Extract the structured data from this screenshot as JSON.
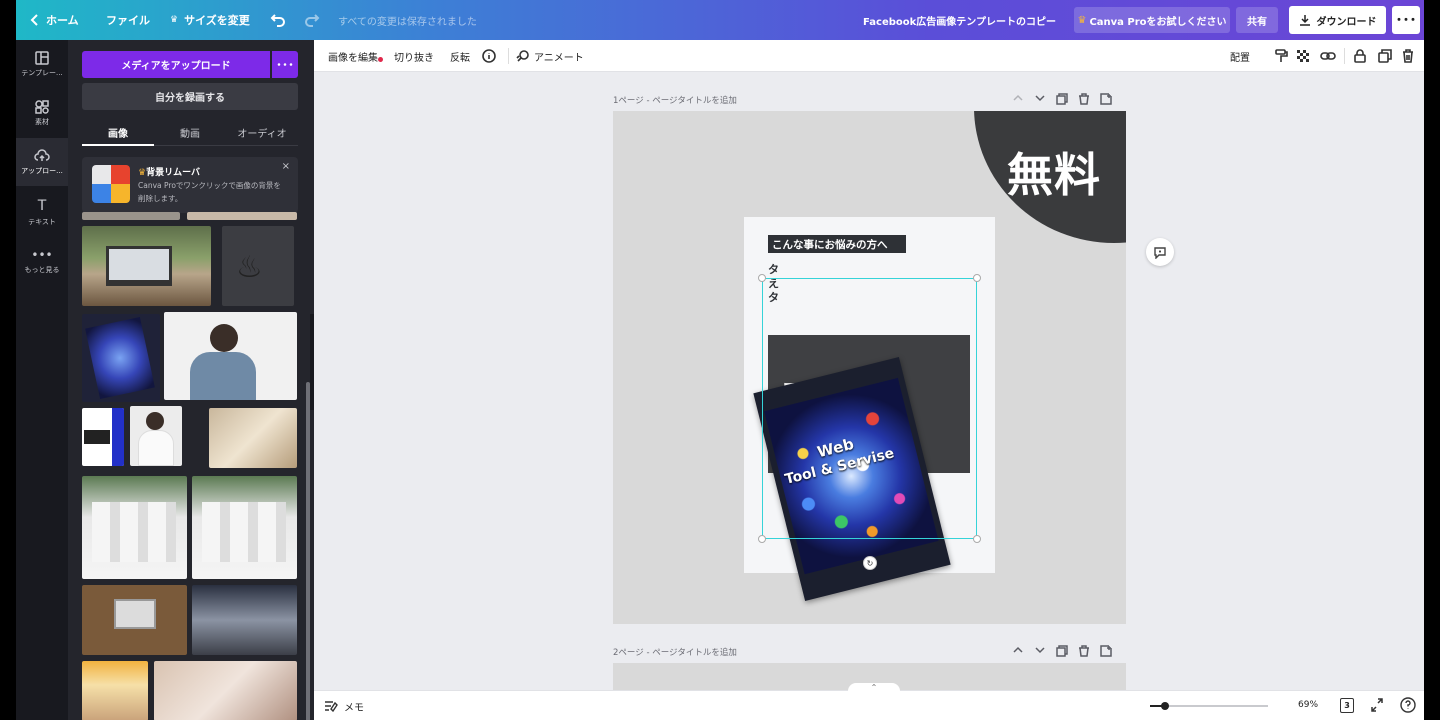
{
  "topbar": {
    "home": "ホーム",
    "file": "ファイル",
    "resize": "サイズを変更",
    "saved_status": "すべての変更は保存されました",
    "doc_title": "Facebook広告画像テンプレートのコピー",
    "try_pro": "Canva Proをお試しください",
    "share": "共有",
    "download": "ダウンロード",
    "more": "･･･"
  },
  "rail": [
    {
      "label": "テンプレー..."
    },
    {
      "label": "素材"
    },
    {
      "label": "アップロー..."
    },
    {
      "label": "テキスト"
    },
    {
      "label": "もっと見る"
    }
  ],
  "panel": {
    "upload_media": "メディアをアップロード",
    "upload_more": "･･･",
    "record": "自分を録画する",
    "tabs": [
      "画像",
      "動画",
      "オーディオ"
    ],
    "bg_remover": {
      "title": "背景リムーバ",
      "desc": "Canva Proでワンクリックで画像の背景を削除します。",
      "close": "×"
    }
  },
  "toolbar": {
    "edit_image": "画像を編集",
    "crop": "切り抜き",
    "flip": "反転",
    "animate": "アニメート",
    "arrange": "配置"
  },
  "canvas": {
    "page1_label": "1ページ - ページタイトルを追加",
    "page2_label": "2ページ - ページタイトルを追加",
    "free": "無料",
    "headline": "こんな事にお悩みの方へ",
    "logo_note": "※ここに会社ロゴを配置",
    "inner_title_1": "Web",
    "inner_title_2": "Tool & Servise"
  },
  "bottombar": {
    "notes": "メモ",
    "zoom": "69%",
    "page_count": "3"
  },
  "colors": {
    "brand_purple": "#7d2ae8",
    "selection": "#35d3d8"
  }
}
